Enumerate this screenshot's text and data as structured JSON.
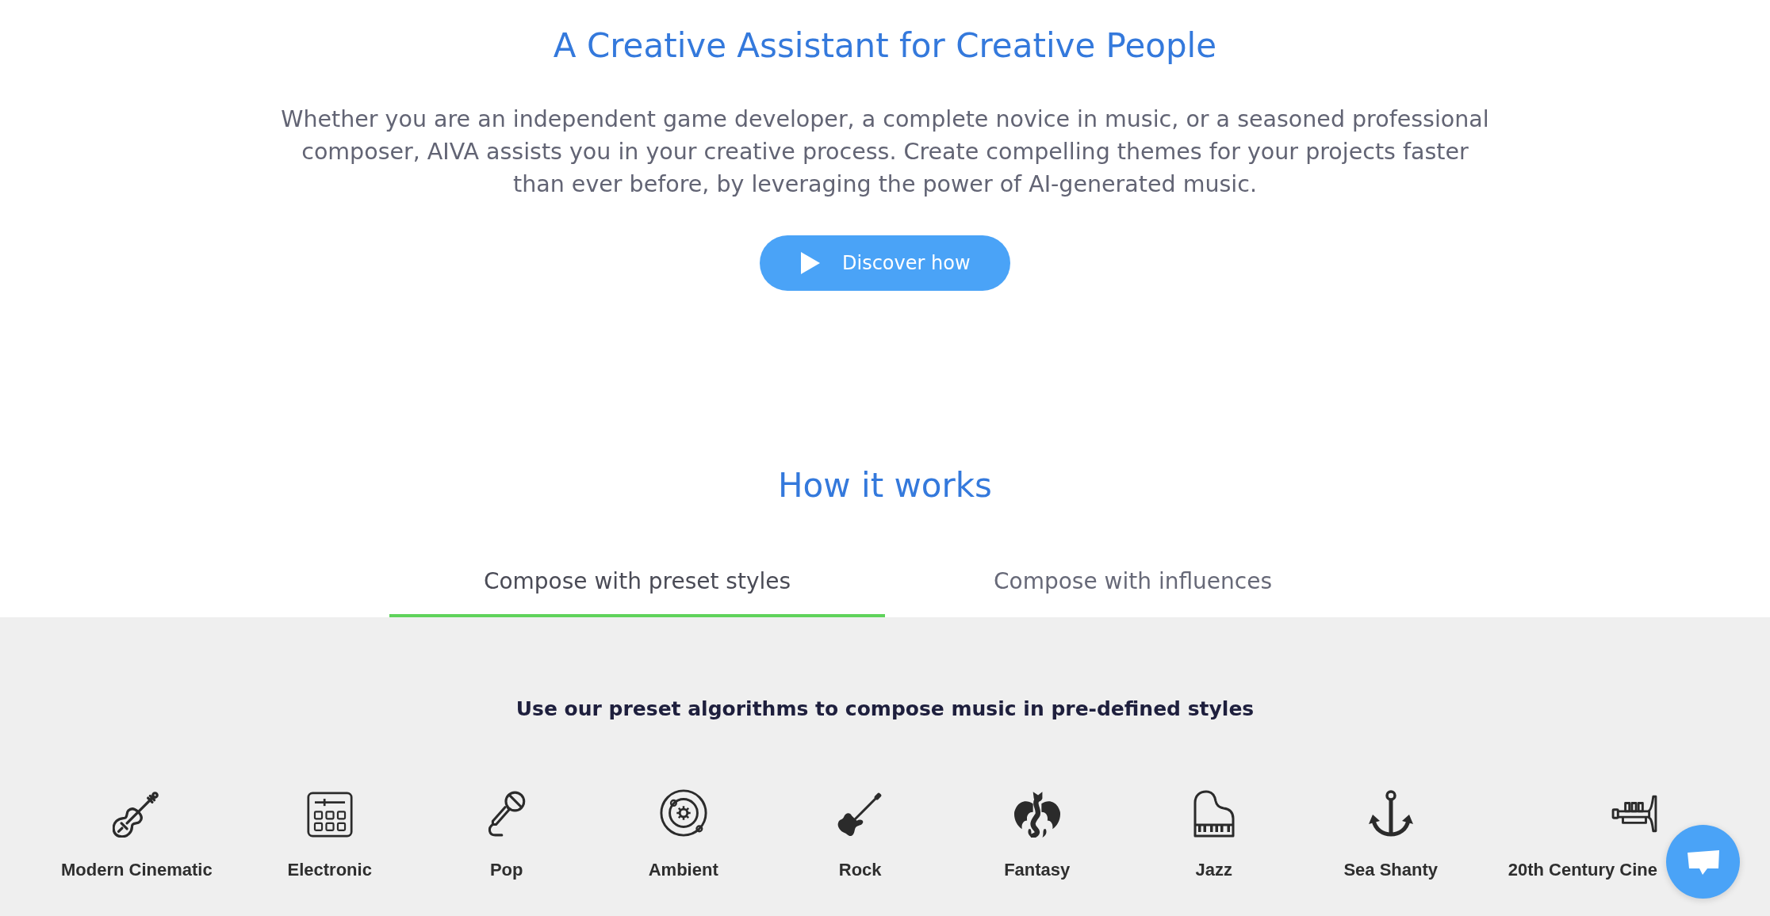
{
  "hero": {
    "title": "A Creative Assistant for Creative People",
    "description": "Whether you are an independent game developer, a complete novice in music, or a seasoned professional composer, AIVA assists you in your creative process. Create compelling themes for your projects faster than ever before, by leveraging the power of AI-generated music.",
    "button": "Discover how"
  },
  "how_it_works": {
    "title": "How it works",
    "tabs": [
      {
        "label": "Compose with preset styles",
        "selected": true
      },
      {
        "label": "Compose with influences",
        "selected": false
      }
    ]
  },
  "preset_styles": {
    "heading": "Use our preset algorithms to compose music in pre-defined styles",
    "styles": [
      "Modern Cinematic",
      "Electronic",
      "Pop",
      "Ambient",
      "Rock",
      "Fantasy",
      "Jazz",
      "Sea Shanty",
      "20th Century Cine"
    ]
  }
}
